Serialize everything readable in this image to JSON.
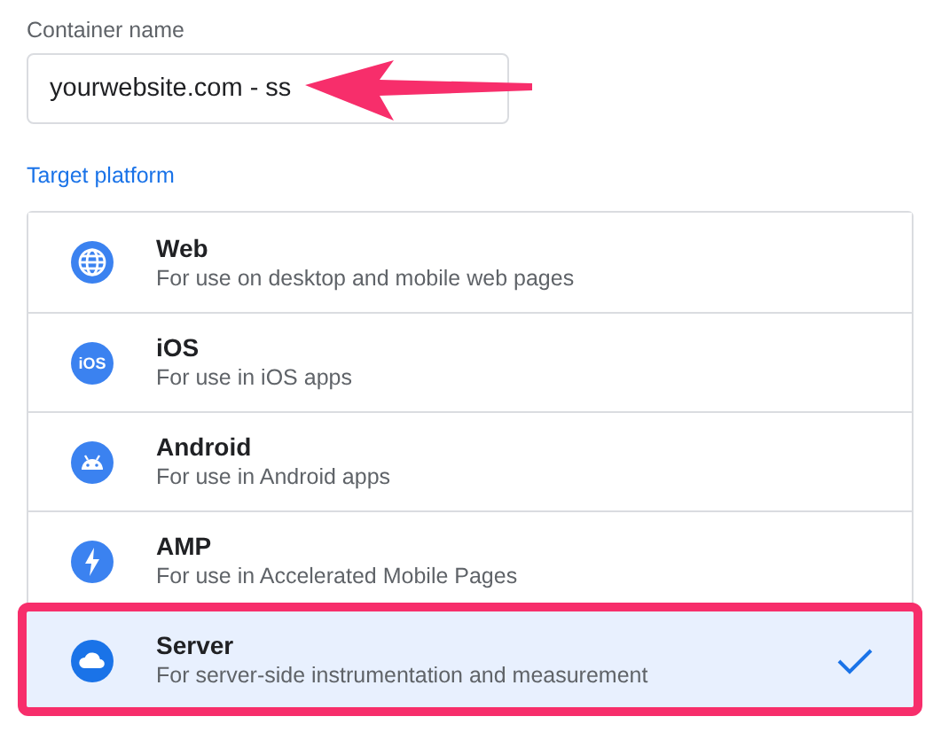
{
  "container_name": {
    "label": "Container name",
    "value": "yourwebsite.com - ss"
  },
  "target_platform": {
    "label": "Target platform",
    "options": [
      {
        "kind": "globe",
        "title": "Web",
        "description": "For use on desktop and mobile web pages",
        "selected": false
      },
      {
        "kind": "badge",
        "icon_text": "iOS",
        "title": "iOS",
        "description": "For use in iOS apps",
        "selected": false
      },
      {
        "kind": "android",
        "title": "Android",
        "description": "For use in Android apps",
        "selected": false
      },
      {
        "kind": "bolt",
        "title": "AMP",
        "description": "For use in Accelerated Mobile Pages",
        "selected": false
      },
      {
        "kind": "cloud",
        "title": "Server",
        "description": "For server-side instrumentation and measurement",
        "selected": true
      }
    ]
  }
}
